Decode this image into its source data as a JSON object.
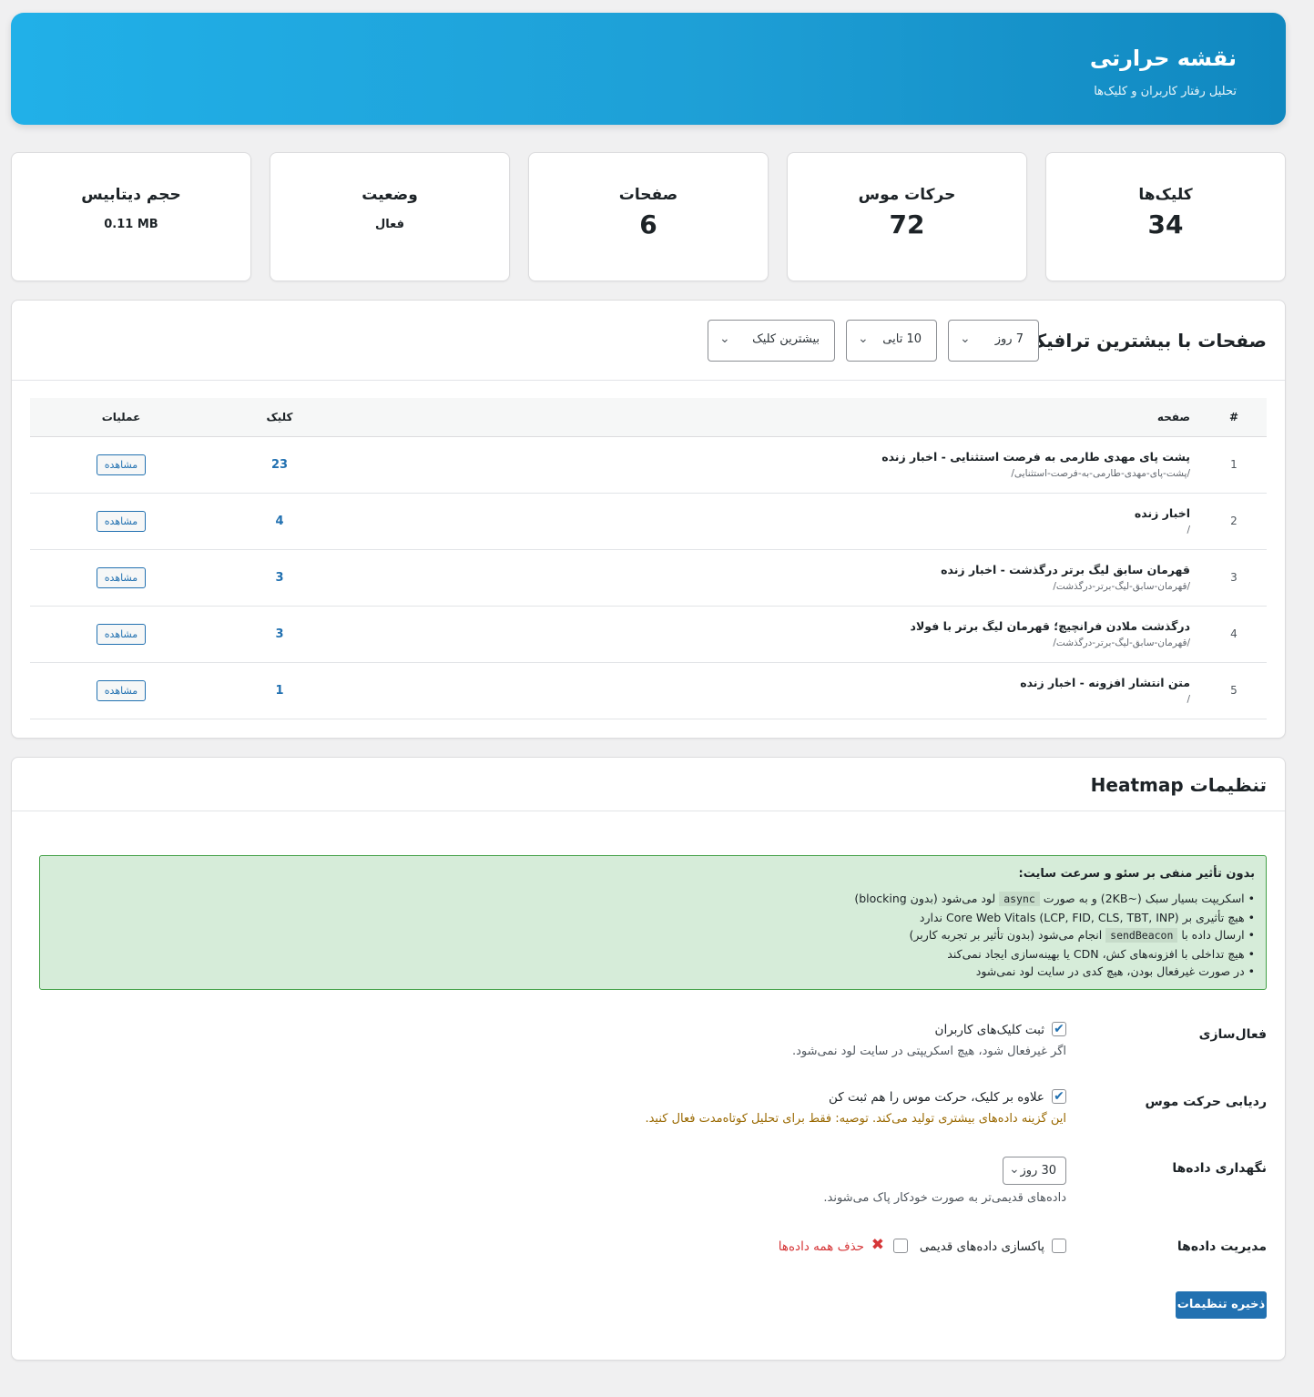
{
  "header": {
    "title": "نقشه حرارتی",
    "subtitle": "تحلیل رفتار کاربران و کلیک‌ها"
  },
  "stats": [
    {
      "label": "کلیک‌ها",
      "value": "34"
    },
    {
      "label": "حرکات موس",
      "value": "72"
    },
    {
      "label": "صفحات",
      "value": "6"
    },
    {
      "label": "وضعیت",
      "value": "فعال"
    },
    {
      "label": "حجم دیتابیس",
      "value": "0.11 MB"
    }
  ],
  "top_pages": {
    "title": "صفحات با بیشترین ترافیک",
    "filters": {
      "period": "7 روز",
      "limit": "10 تایی",
      "sort": "بیشترین کلیک"
    },
    "columns": {
      "num": "#",
      "page": "صفحه",
      "clicks": "کلیک",
      "ops": "عملیات"
    },
    "view_label": "مشاهده",
    "rows": [
      {
        "num": "1",
        "title": "پشت پای مهدی طارمی به فرصت استثنایی - اخبار زنده",
        "url": "/پشت-پای-مهدی-طارمی-به-فرصت-استثنایی/",
        "clicks": "23"
      },
      {
        "num": "2",
        "title": "اخبار زنده",
        "url": "/",
        "clicks": "4"
      },
      {
        "num": "3",
        "title": "قهرمان سابق لیگ برتر درگذشت - اخبار زنده",
        "url": "/قهرمان-سابق-لیگ-برتر-درگذشت/",
        "clicks": "3"
      },
      {
        "num": "4",
        "title": "درگذشت ملادن فرانچیچ؛ قهرمان لیگ برتر با فولاد",
        "url": "/قهرمان-سابق-لیگ-برتر-درگذشت/",
        "clicks": "3"
      },
      {
        "num": "5",
        "title": "متن انتشار افزونه - اخبار زنده",
        "url": "/",
        "clicks": "1"
      }
    ]
  },
  "settings": {
    "title": "تنظیمات Heatmap",
    "notice": {
      "title": "بدون تأثیر منفی بر سئو و سرعت سایت:",
      "line1_a": "• اسکریپت بسیار سبک (~2KB) و به صورت",
      "line1_code": "async",
      "line1_b": "لود می‌شود (بدون blocking)",
      "line2": "• هیچ تأثیری بر Core Web Vitals (LCP, FID, CLS, TBT, INP) ندارد",
      "line3_a": "• ارسال داده با",
      "line3_code": "sendBeacon",
      "line3_b": "انجام می‌شود (بدون تأثیر بر تجربه کاربر)",
      "line4": "• هیچ تداخلی با افزونه‌های کش، CDN یا بهینه‌سازی ایجاد نمی‌کند",
      "line5": "• در صورت غیرفعال بودن، هیچ کدی در سایت لود نمی‌شود"
    },
    "activation": {
      "label": "فعال‌سازی",
      "checkbox": "ثبت کلیک‌های کاربران",
      "checked": true,
      "desc": "اگر غیرفعال شود، هیچ اسکریپتی در سایت لود نمی‌شود."
    },
    "mouse": {
      "label": "ردیابی حرکت موس",
      "checkbox": "علاوه بر کلیک، حرکت موس را هم ثبت کن",
      "checked": true,
      "desc": "این گزینه داده‌های بیشتری تولید می‌کند. توصیه: فقط برای تحلیل کوتاه‌مدت فعال کنید."
    },
    "retention": {
      "label": "نگهداری داده‌ها",
      "value": "30 روز",
      "desc": "داده‌های قدیمی‌تر به صورت خودکار پاک می‌شوند."
    },
    "data_mgmt": {
      "label": "مدیریت داده‌ها",
      "cleanup": "پاکسازی داده‌های قدیمی",
      "delete_all": "حذف همه داده‌ها",
      "delete_icon": "✖"
    },
    "save_label": "ذخیره تنظیمات"
  },
  "colors": {
    "accent": "#2271b1",
    "hero_start": "#21b0e8",
    "hero_end": "#1088c0",
    "notice_bg": "#d6ecd9",
    "notice_border": "#43a047"
  }
}
